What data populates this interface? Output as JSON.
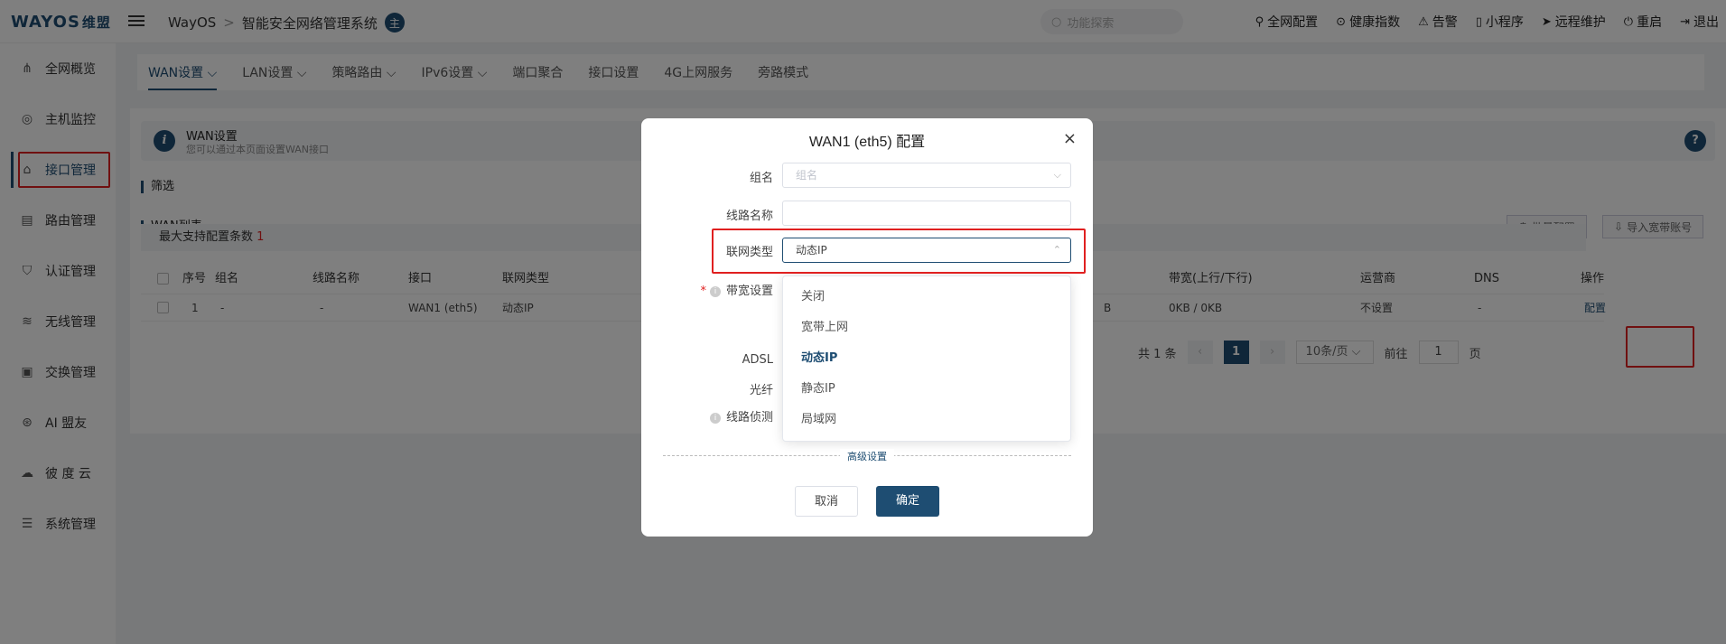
{
  "brand": {
    "logo": "WAYOS",
    "logo_cn": "维盟"
  },
  "header": {
    "crumb_root": "WayOS",
    "crumb_sep": ">",
    "crumb_title": "智能安全网络管理系统",
    "badge": "主",
    "search_placeholder": "功能探索",
    "actions": [
      "全网配置",
      "健康指数",
      "告警",
      "小程序",
      "远程维护",
      "重启",
      "退出"
    ]
  },
  "sidebar": {
    "items": [
      {
        "label": "全网概览",
        "icon": "network-tree-icon"
      },
      {
        "label": "主机监控",
        "icon": "user-circle-icon"
      },
      {
        "label": "接口管理",
        "icon": "home-icon"
      },
      {
        "label": "路由管理",
        "icon": "router-icon"
      },
      {
        "label": "认证管理",
        "icon": "shield-icon"
      },
      {
        "label": "无线管理",
        "icon": "wifi-icon"
      },
      {
        "label": "交换管理",
        "icon": "switch-icon"
      },
      {
        "label": "AI 盟友",
        "icon": "ai-icon"
      },
      {
        "label": "彼 度 云",
        "icon": "cloud-icon"
      },
      {
        "label": "系统管理",
        "icon": "sliders-icon"
      }
    ]
  },
  "tabs": [
    "WAN设置",
    "LAN设置",
    "策略路由",
    "IPv6设置",
    "端口聚合",
    "接口设置",
    "4G上网服务",
    "旁路模式"
  ],
  "info": {
    "title": "WAN设置",
    "desc": "您可以通过本页面设置WAN接口"
  },
  "filter_title": "筛选",
  "list_title": "WAN列表",
  "buttons": {
    "batch": "批量配置",
    "import": "导入宽带账号"
  },
  "max_config": {
    "label": "最大支持配置条数",
    "value": "1"
  },
  "table": {
    "headers": [
      "序号",
      "组名",
      "线路名称",
      "接口",
      "联网类型",
      "带宽(上行/下行)",
      "运营商",
      "DNS",
      "操作"
    ],
    "row": {
      "index": "1",
      "group": "-",
      "line": "-",
      "iface": "WAN1 (eth5)",
      "type": "动态IP",
      "partial": "B",
      "bandwidth": "0KB / 0KB",
      "isp": "不设置",
      "dns": "-",
      "op": "配置"
    }
  },
  "pager": {
    "total": "共 1 条",
    "current": "1",
    "size": "10条/页",
    "goto": "前往",
    "goto_value": "1",
    "page": "页"
  },
  "modal": {
    "title": "WAN1 (eth5) 配置",
    "close": "×",
    "fields": {
      "group": {
        "label": "组名",
        "placeholder": "组名"
      },
      "line": {
        "label": "线路名称",
        "value": ""
      },
      "net_type": {
        "label": "联网类型",
        "value": "动态IP"
      },
      "bandwidth": {
        "label": "带宽设置"
      },
      "adsl": {
        "label": "ADSL"
      },
      "fiber": {
        "label": "光纤"
      },
      "detect": {
        "label": "线路侦测"
      }
    },
    "options": [
      "关闭",
      "宽带上网",
      "动态IP",
      "静态IP",
      "局域网"
    ],
    "selected_option": "动态IP",
    "advanced": "高级设置",
    "cancel": "取消",
    "ok": "确定"
  }
}
